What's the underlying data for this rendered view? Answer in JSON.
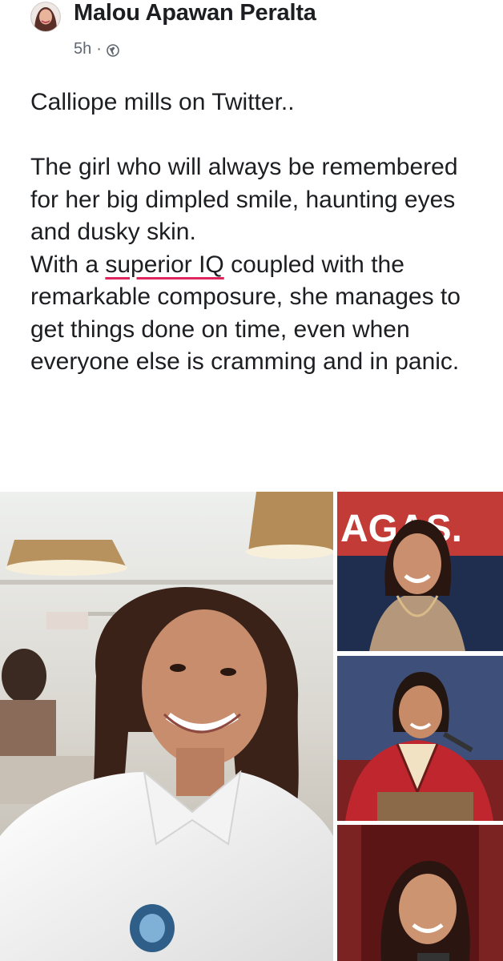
{
  "post": {
    "author": "Malou Apawan Peralta",
    "time": "5h",
    "separator": "·",
    "audience_icon": "globe-icon",
    "intro": "Calliope mills on Twitter..",
    "paragraph_1": "The girl who will always be remembered for her big dimpled smile, haunting eyes and dusky skin.",
    "paragraph_2_before": "With a ",
    "paragraph_2_highlight": "superior IQ",
    "paragraph_2_after": " coupled with the remarkable composure, she manages to get things done on time, even when everyone else is cramming and in panic."
  },
  "photos": {
    "banner_text": "AGAS."
  },
  "colors": {
    "text": "#1c1e21",
    "meta": "#606770",
    "highlight_underline": "#e0245e"
  }
}
